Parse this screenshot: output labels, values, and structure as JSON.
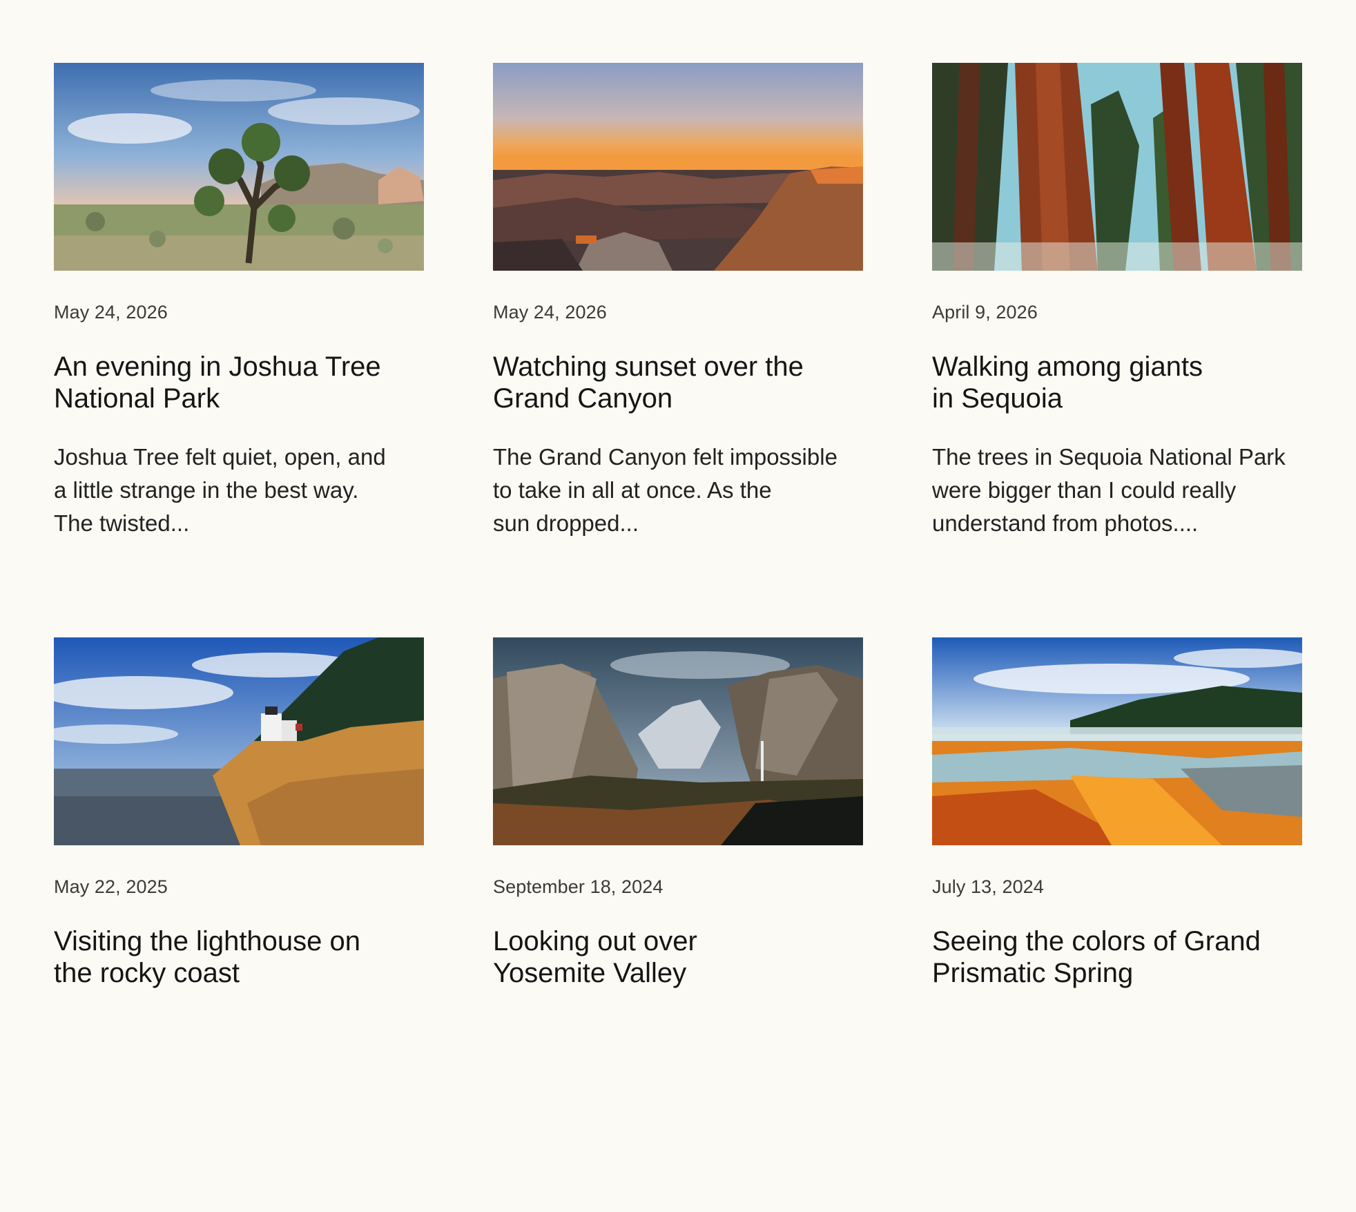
{
  "posts": [
    {
      "image_icon": "joshua-tree-photo",
      "date": "May 24, 2026",
      "title_line1": "An evening in Joshua Tree",
      "title_line2": "National Park",
      "excerpt_line1": "Joshua Tree felt quiet, open, and",
      "excerpt_line2": "a little strange in the best way.",
      "excerpt_line3": "The twisted..."
    },
    {
      "image_icon": "grand-canyon-photo",
      "date": "May 24, 2026",
      "title_line1": "Watching sunset over the",
      "title_line2": "Grand Canyon",
      "excerpt_line1": "The Grand Canyon felt impossible",
      "excerpt_line2": "to take in all at once. As the",
      "excerpt_line3": "sun dropped..."
    },
    {
      "image_icon": "sequoia-photo",
      "date": "April 9, 2026",
      "title_line1": "Walking among giants",
      "title_line2": "in Sequoia",
      "excerpt_line1": "The trees in Sequoia National Park",
      "excerpt_line2": "were bigger than I could really",
      "excerpt_line3": "understand from photos...."
    },
    {
      "image_icon": "lighthouse-photo",
      "date": "May 22, 2025",
      "title_line1": "Visiting the lighthouse on",
      "title_line2": "the rocky coast",
      "excerpt_line1": "",
      "excerpt_line2": "",
      "excerpt_line3": ""
    },
    {
      "image_icon": "yosemite-valley-photo",
      "date": "September 18, 2024",
      "title_line1": "Looking out over",
      "title_line2": "Yosemite Valley",
      "excerpt_line1": "",
      "excerpt_line2": "",
      "excerpt_line3": ""
    },
    {
      "image_icon": "grand-prismatic-photo",
      "date": "July 13, 2024",
      "title_line1": "Seeing the colors of Grand",
      "title_line2": "Prismatic Spring",
      "excerpt_line1": "",
      "excerpt_line2": "",
      "excerpt_line3": ""
    }
  ]
}
